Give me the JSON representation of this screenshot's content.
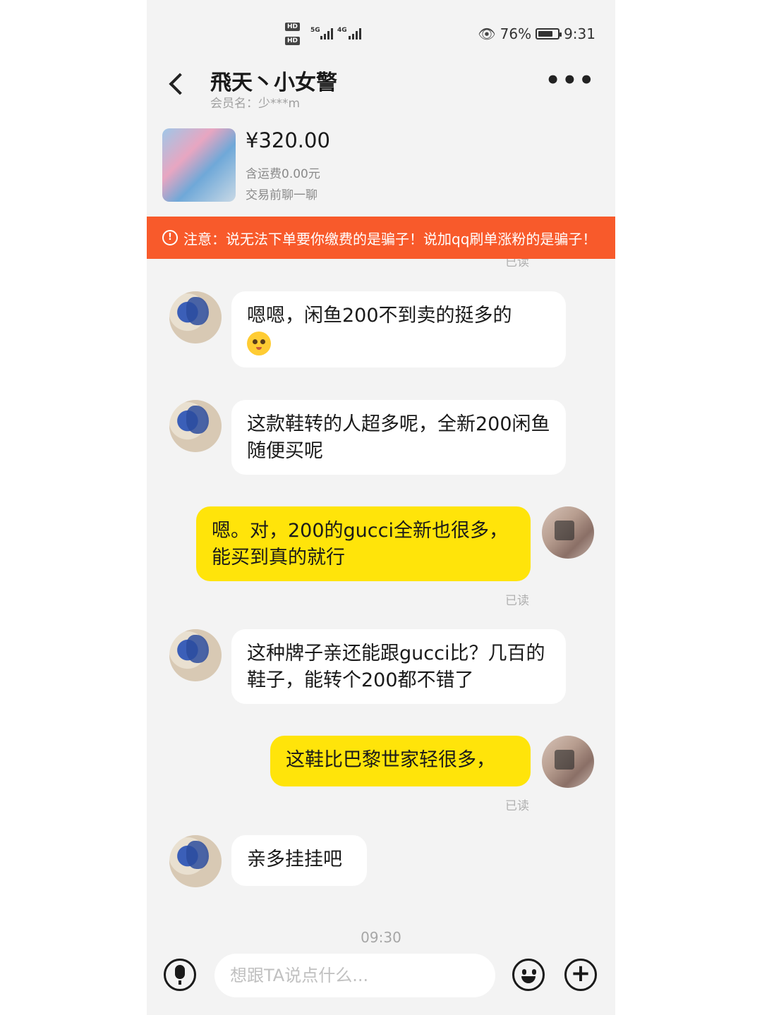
{
  "status": {
    "net1": "5G",
    "net2": "4G",
    "hd": "HD",
    "battery_text": "76%",
    "battery_level": 0.76,
    "time": "9:31"
  },
  "header": {
    "back_icon": "chevron-left-icon",
    "name": "飛天丶小女警",
    "member": "会员名：少***m",
    "more_label": "•••"
  },
  "product": {
    "price": "¥320.00",
    "shipping": "含运费0.00元",
    "chat_before": "交易前聊一聊"
  },
  "warning": {
    "icon": "!",
    "text": "注意：说无法下单要你缴费的是骗子！说加qq刷单涨粉的是骗子！"
  },
  "chat": {
    "top_read": "已读",
    "messages": [
      {
        "from": "other",
        "text": "嗯嗯，闲鱼200不到卖的挺多的"
      },
      {
        "from": "other",
        "text": "这款鞋转的人超多呢，全新200闲鱼随便买呢"
      },
      {
        "from": "self",
        "text": "嗯。对，200的gucci全新也很多，能买到真的就行",
        "read": "已读"
      },
      {
        "from": "other",
        "text": "这种牌子亲还能跟gucci比？几百的鞋子，能转个200都不错了"
      },
      {
        "from": "self",
        "text": "这鞋比巴黎世家轻很多，",
        "read": "已读"
      },
      {
        "from": "other",
        "text": "亲多挂挂吧"
      }
    ],
    "time": "09:30"
  },
  "input": {
    "placeholder": "想跟TA说点什么..."
  },
  "colors": {
    "warning_bg": "#f85a2b",
    "self_bubble": "#ffe40a",
    "other_bubble": "#ffffff",
    "background": "#f3f3f3"
  }
}
